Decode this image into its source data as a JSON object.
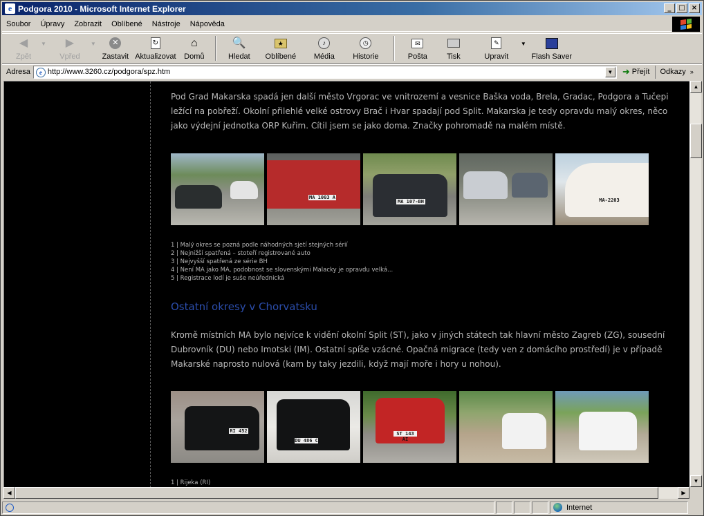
{
  "window": {
    "title": "Podgora 2010 - Microsoft Internet Explorer",
    "controls": [
      "_",
      "□",
      "×"
    ]
  },
  "menu": [
    "Soubor",
    "Úpravy",
    "Zobrazit",
    "Oblíbené",
    "Nástroje",
    "Nápověda"
  ],
  "toolbar": {
    "back": "Zpět",
    "forward": "Vpřed",
    "stop": "Zastavit",
    "refresh": "Aktualizovat",
    "home": "Domů",
    "search": "Hledat",
    "favorites": "Oblíbené",
    "media": "Média",
    "history": "Historie",
    "mail": "Pošta",
    "print": "Tisk",
    "edit": "Upravit",
    "flash": "Flash Saver"
  },
  "address": {
    "label": "Adresa",
    "url": "http://www.3260.cz/podgora/spz.htm",
    "go": "Přejít",
    "links": "Odkazy"
  },
  "page": {
    "intro": "Pod Grad Makarska spadá jen další město Vrgorac ve vnitrozemí a vesnice Baška voda, Brela, Gradac, Podgora a Tučepi ležící na pobřeží. Okolní přilehlé velké ostrovy Brač i Hvar spadají pod Split. Makarska je tedy opravdu malý okres, něco jako výdejní jednotka ORP Kuřim. Cítil jsem se jako doma. Značky pohromadě na malém místě.",
    "row1_plates": [
      "",
      "MA 1003 A",
      "MA 107-BH",
      "",
      "MA-2203"
    ],
    "captions1": [
      "1 | Malý okres se pozná podle náhodných sjetí stejných sérií",
      "2 | Nejnižší spatřená – stoteří registrované auto",
      "3 | Nejvyšší spatřená ze série BH",
      "4 | Není MA jako MA, podobnost se slovenskými Malacky je opravdu velká...",
      "5 | Registrace lodí je suše neúřednická"
    ],
    "heading": "Ostatní okresy v Chorvatsku",
    "para2": "Kromě místních MA bylo nejvíce k vidění okolní Split (ST), jako v jiných státech tak hlavní město Zagreb (ZG), sousední Dubrovník (DU) nebo Imotski (IM). Ostatní spíše vzácné. Opačná migrace (tedy ven z domácího prostředí) je v případě Makarské naprosto nulová (kam by taky jezdili, když mají moře i hory u nohou).",
    "row2_plates": [
      "RI 452 C",
      "DU 486 C",
      "ST 143 AI",
      "",
      ""
    ],
    "captions2": [
      "1 | Rijeka (RI)"
    ]
  },
  "status": {
    "zone": "Internet"
  }
}
